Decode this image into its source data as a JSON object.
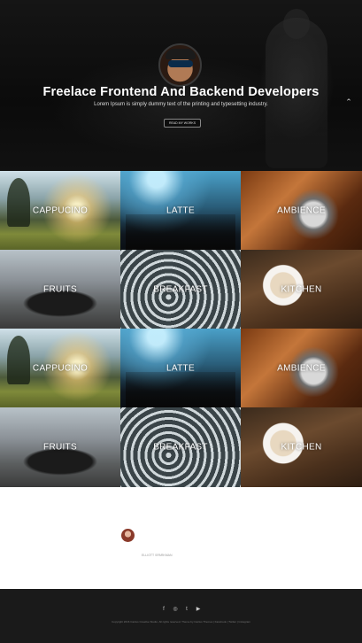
{
  "hero": {
    "title": "Freelace Frontend And Backend Developers",
    "subtitle": "Lorem Ipsum is simply dummy text of the printing and typesetting industry.",
    "button_label": "READ MY WORKS",
    "scroll_up_icon": "chevron-up-icon"
  },
  "gallery": {
    "tiles": [
      {
        "label": "CAPPUCINO"
      },
      {
        "label": "LATTE"
      },
      {
        "label": "AMBIENCE"
      },
      {
        "label": "FRUITS"
      },
      {
        "label": "BREAKFAST"
      },
      {
        "label": "KITCHEN"
      },
      {
        "label": "CAPPUCINO"
      },
      {
        "label": "LATTE"
      },
      {
        "label": "AMBIENCE"
      },
      {
        "label": "FRUITS"
      },
      {
        "label": "BREAKFAST"
      },
      {
        "label": "KITCHEN"
      }
    ]
  },
  "testimonial": {
    "name": "ELLIOTT SPARKMAN"
  },
  "footer": {
    "social": [
      "f",
      "◎",
      "t",
      "▶"
    ],
    "copyright": "Copyright 2016 Cactus Creative Studio. All rights reserved. Theme by Cactus Themes | Facebook | Twitter | Instagram"
  },
  "colors": {
    "hero_bg": "#0c0c0c",
    "footer_bg": "#1a1a1a",
    "testimonial_bg": "#ffffff"
  }
}
